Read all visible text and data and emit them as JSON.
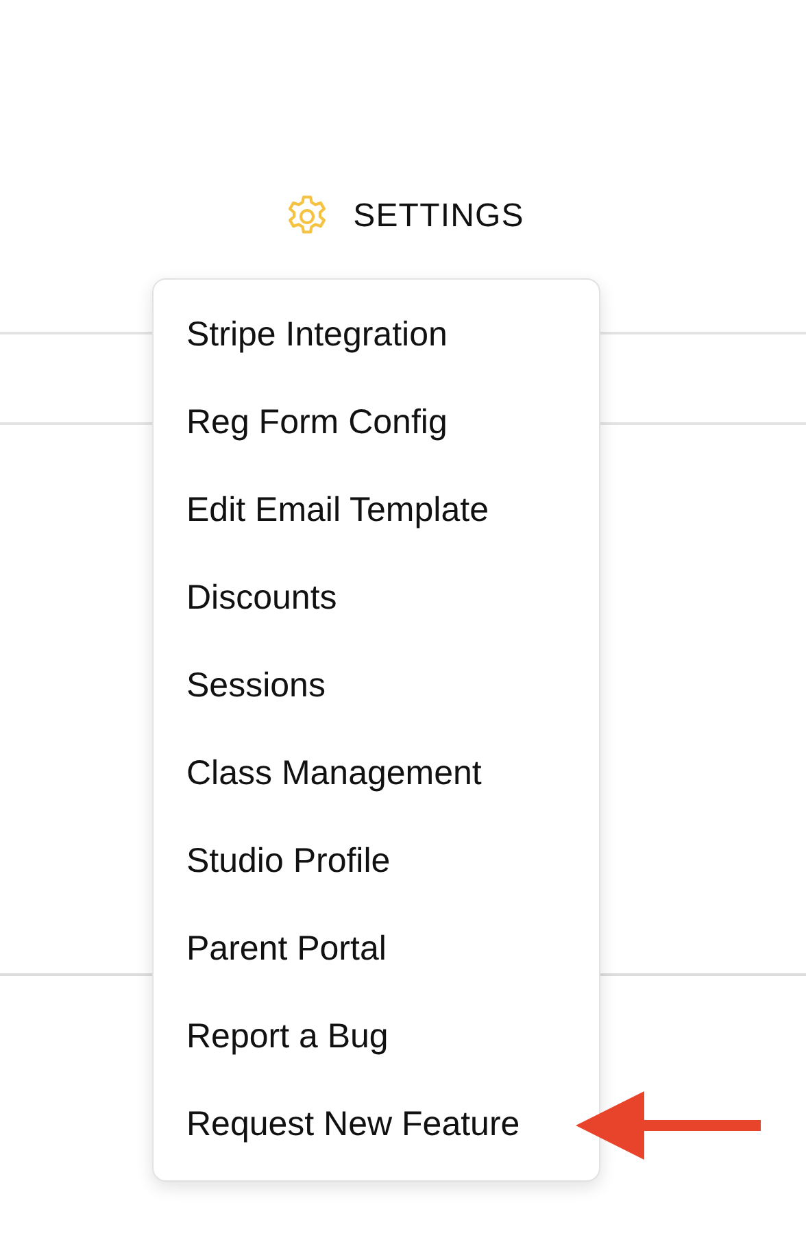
{
  "header": {
    "title": "SETTINGS"
  },
  "menu": {
    "items": [
      {
        "label": "Stripe Integration"
      },
      {
        "label": "Reg Form Config"
      },
      {
        "label": "Edit Email Template"
      },
      {
        "label": "Discounts"
      },
      {
        "label": "Sessions"
      },
      {
        "label": "Class Management"
      },
      {
        "label": "Studio Profile"
      },
      {
        "label": "Parent Portal"
      },
      {
        "label": "Report a Bug"
      },
      {
        "label": "Request New Feature"
      }
    ]
  }
}
